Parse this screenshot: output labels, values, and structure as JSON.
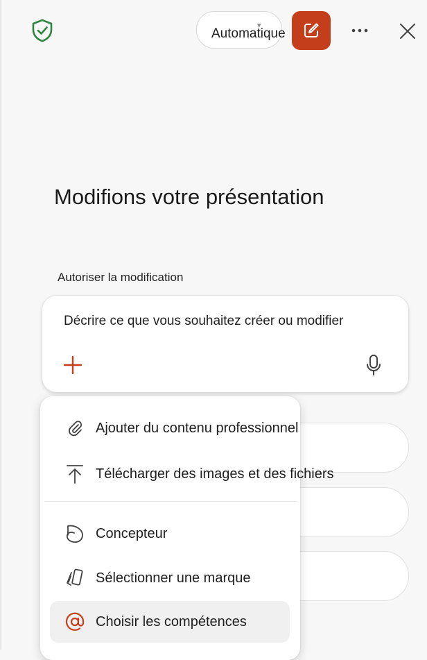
{
  "header": {
    "mode": {
      "label": "Automatique",
      "chevron": "chevron-down-icon"
    },
    "icons": {
      "security": "shield-check-icon",
      "edit": "edit-icon",
      "more": "more-icon",
      "close": "close-icon"
    }
  },
  "main": {
    "title": "Modifions votre présentation",
    "section_label": "Autoriser la modification",
    "prompt": {
      "placeholder": "Décrire ce que vous souhaitez créer ou modifier"
    }
  },
  "menu": {
    "items": [
      {
        "label": "Ajouter du contenu professionnel",
        "icon": "paperclip-icon"
      },
      {
        "label": "Télécharger des images et des fichiers",
        "icon": "upload-icon"
      },
      {
        "label": "Concepteur",
        "icon": "designer-icon"
      },
      {
        "label": "Sélectionner une marque",
        "icon": "brand-icon"
      },
      {
        "label": "Choisir les compétences",
        "icon": "at-icon",
        "selected": true
      }
    ]
  },
  "colors": {
    "accent": "#c43e1c",
    "shield": "#2e8540",
    "background": "#f7f7f7",
    "selected_item": "#f0f0f0"
  }
}
